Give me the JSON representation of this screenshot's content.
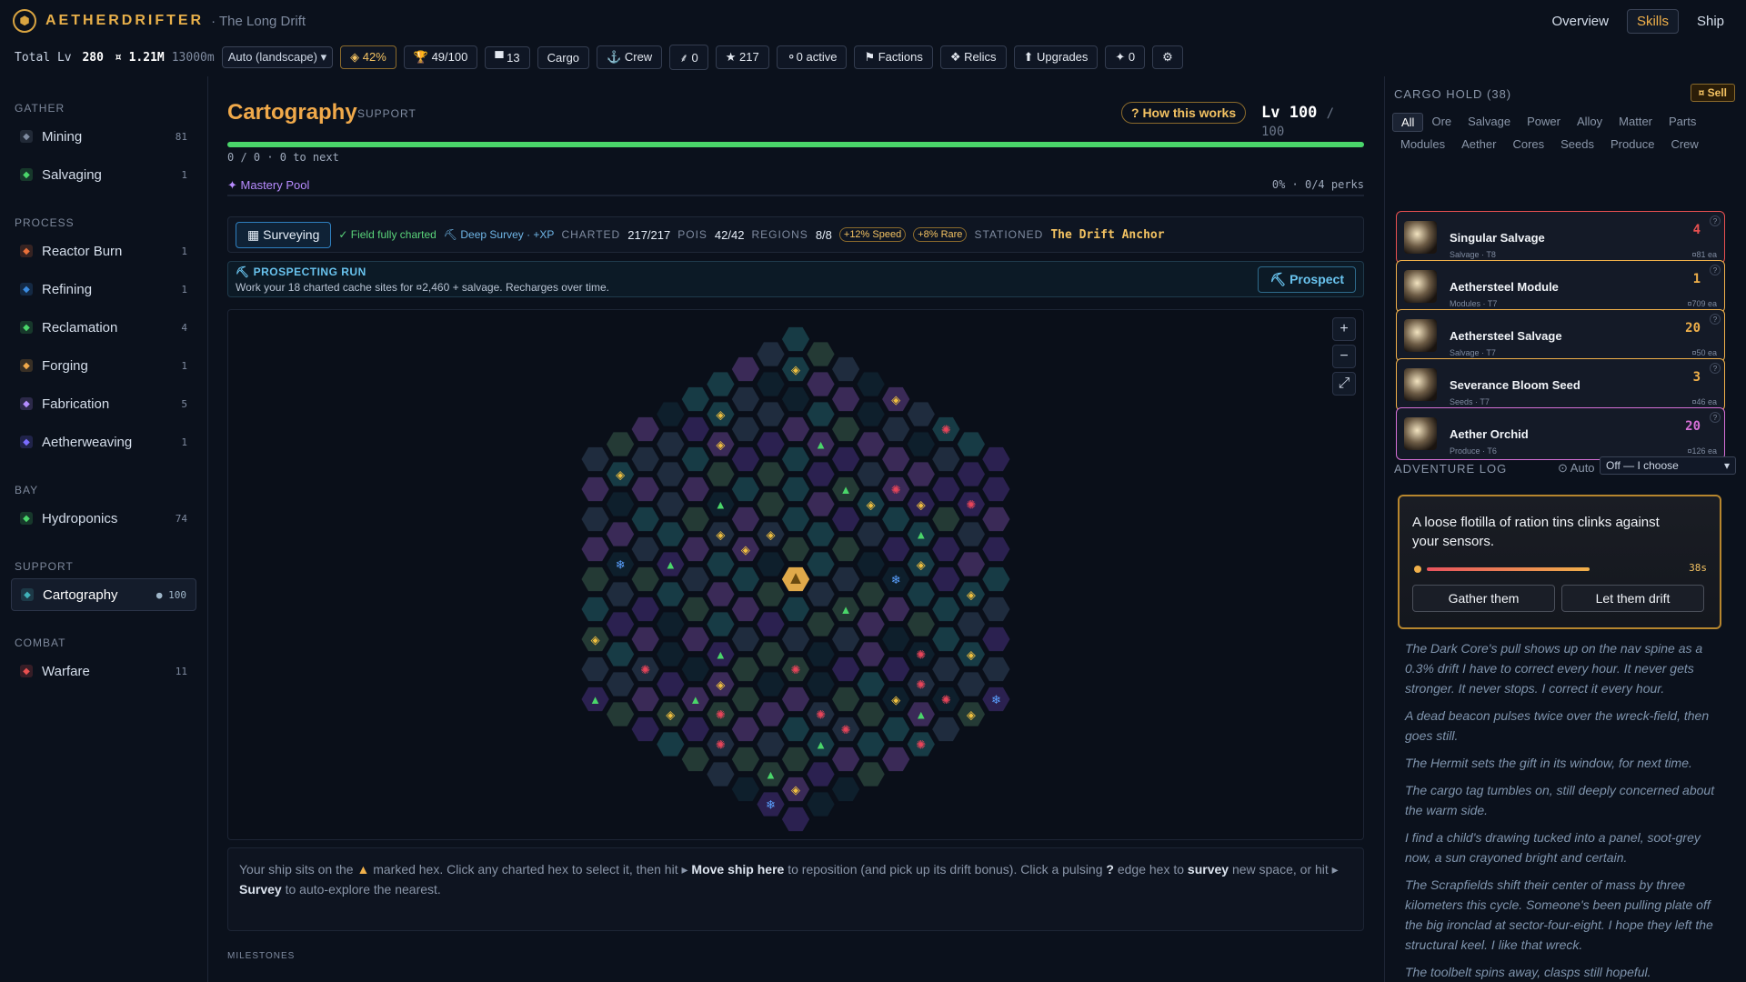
{
  "header": {
    "brand": "AETHERDRIFTER",
    "subtitle": "· The Long Drift",
    "nav": [
      "Overview",
      "Skills",
      "Ship"
    ],
    "active_nav": "Skills"
  },
  "stats": {
    "total_lv_label": "Total Lv",
    "total_lv": "280",
    "credits": "¤ 1.21M",
    "distance": "13000m",
    "layout": "Auto (landscape)",
    "chips": [
      "◈ 42%",
      "🏆 49/100",
      "▀ 13",
      "Cargo",
      "⚓ Crew",
      "⸙ 0",
      "★ 217",
      "⚬0 active",
      "⚑ Factions",
      "❖ Relics",
      "⬆ Upgrades",
      "✦ 0",
      "⚙"
    ]
  },
  "sidebar": {
    "groups": [
      {
        "name": "GATHER",
        "items": [
          {
            "label": "Mining",
            "n": "81",
            "c": "#7f8ba0"
          },
          {
            "label": "Salvaging",
            "n": "1",
            "c": "#4ad66a"
          }
        ]
      },
      {
        "name": "PROCESS",
        "items": [
          {
            "label": "Reactor Burn",
            "n": "1",
            "c": "#e8703a"
          },
          {
            "label": "Refining",
            "n": "1",
            "c": "#3a8be0"
          },
          {
            "label": "Reclamation",
            "n": "4",
            "c": "#4ad66a"
          },
          {
            "label": "Forging",
            "n": "1",
            "c": "#f0a94a"
          },
          {
            "label": "Fabrication",
            "n": "5",
            "c": "#b48cff"
          },
          {
            "label": "Aetherweaving",
            "n": "1",
            "c": "#7a6cff"
          }
        ]
      },
      {
        "name": "BAY",
        "items": [
          {
            "label": "Hydroponics",
            "n": "74",
            "c": "#4ad66a"
          }
        ]
      },
      {
        "name": "SUPPORT",
        "items": [
          {
            "label": "Cartography",
            "n": "● 100",
            "c": "#3fb1b8",
            "active": true
          }
        ]
      },
      {
        "name": "COMBAT",
        "items": [
          {
            "label": "Warfare",
            "n": "11",
            "c": "#e85050"
          }
        ]
      }
    ]
  },
  "main": {
    "title": "Cartography",
    "title_sub": "SUPPORT",
    "how": "? How this works",
    "lv": "Lv 100",
    "lv_max": "/ 100",
    "xp_fraction": 1.0,
    "xp_text": "0 / 0 · 0 to next",
    "mastery": "✦ Mastery Pool",
    "perks": "0% · 0/4 perks",
    "status": {
      "button": "▦ Surveying",
      "charted_ok": "✓ Field fully charted",
      "deep": "⛏ Deep Survey · +XP",
      "charted_label": "CHARTED",
      "charted": "217/217",
      "pois_label": "POIS",
      "pois": "42/42",
      "regions_label": "REGIONS",
      "regions": "8/8",
      "speed": "+12% Speed",
      "rare": "+8% Rare",
      "stationed_label": "STATIONED",
      "stationed": "The Drift Anchor"
    },
    "prospect": {
      "heading": "⛏ PROSPECTING RUN",
      "desc": "Work your 18 charted cache sites for ¤2,460 + salvage. Recharges over time.",
      "button": "⛏ Prospect"
    },
    "zoom": [
      "+",
      "−",
      "⤢"
    ],
    "help": {
      "p1": "Your ship sits on the ",
      "p2": " marked hex. Click any charted hex to select it, then hit ▸ ",
      "b1": "Move ship here",
      "p3": " to reposition (and pick up its drift bonus). Click a pulsing ",
      "b2": "?",
      "p4": " edge hex to ",
      "b3": "survey",
      "p5": " new space, or hit ▸ ",
      "b4": "Survey",
      "p6": " to auto-explore the nearest."
    },
    "milestones": "MILESTONES"
  },
  "cargo": {
    "title": "CARGO HOLD (38)",
    "sell": "¤ Sell",
    "filters": [
      "All",
      "Ore",
      "Salvage",
      "Power",
      "Alloy",
      "Matter",
      "Parts",
      "Modules",
      "Aether",
      "Cores",
      "Seeds",
      "Produce",
      "Crew"
    ],
    "items": [
      {
        "name": "Singular Salvage",
        "meta": "Salvage · T8",
        "qty": "4",
        "price": "¤81 ea",
        "color": "#e85050"
      },
      {
        "name": "Aethersteel Module",
        "meta": "Modules · T7",
        "qty": "1",
        "price": "¤709 ea",
        "color": "#f0b04a"
      },
      {
        "name": "Aethersteel Salvage",
        "meta": "Salvage · T7",
        "qty": "20",
        "price": "¤50 ea",
        "color": "#f0b04a"
      },
      {
        "name": "Severance Bloom Seed",
        "meta": "Seeds · T7",
        "qty": "3",
        "price": "¤46 ea",
        "color": "#f0b04a"
      },
      {
        "name": "Aether Orchid",
        "meta": "Produce · T6",
        "qty": "20",
        "price": "¤126 ea",
        "color": "#d56fd6"
      }
    ]
  },
  "adventure": {
    "title": "ADVENTURE LOG",
    "auto": "⊙ Auto",
    "mode": "Off — I choose",
    "event": "A loose flotilla of ration tins clinks against your sensors.",
    "time": "38s",
    "time_fraction": 0.85,
    "opt1": "Gather them",
    "opt2": "Let them drift",
    "log": [
      "The Dark Core's pull shows up on the nav spine as a 0.3% drift I have to correct every hour. It never gets stronger. It never stops. I correct it every hour.",
      "A dead beacon pulses twice over the wreck-field, then goes still.",
      "The Hermit sets the gift in its window, for next time.",
      "The cargo tag tumbles on, still deeply concerned about the warm side.",
      "I find a child's drawing tucked into a panel, soot-grey now, a sun crayoned bright and certain.",
      "The Scrapfields shift their center of mass by three kilometers this cycle. Someone's been pulling plate off the big ironclad at sector-four-eight. I hope they left the structural keel. I like that wreck.",
      "The toolbelt spins away, clasps still hopeful."
    ]
  }
}
